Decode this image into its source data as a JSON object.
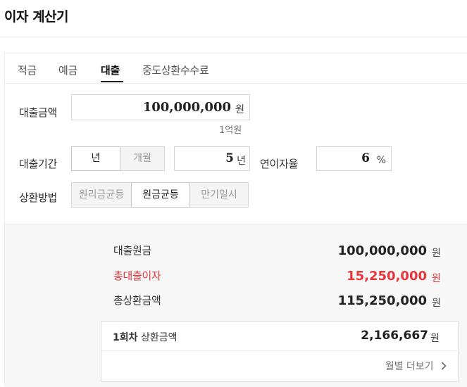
{
  "header": {
    "title": "이자 계산기"
  },
  "tabs": [
    {
      "label": "적금",
      "active": false
    },
    {
      "label": "예금",
      "active": false
    },
    {
      "label": "대출",
      "active": true
    },
    {
      "label": "중도상환수수료",
      "active": false
    }
  ],
  "loan_amount": {
    "label": "대출금액",
    "value": "100,000,000",
    "unit": "원",
    "hint": "1억원"
  },
  "loan_period": {
    "label": "대출기간",
    "options": [
      {
        "label": "년",
        "selected": true
      },
      {
        "label": "개월",
        "selected": false
      }
    ],
    "value": "5",
    "unit": "년"
  },
  "interest_rate": {
    "label": "연이자율",
    "value": "6",
    "unit": "%"
  },
  "repayment_method": {
    "label": "상환방법",
    "options": [
      {
        "label": "원리금균등",
        "selected": false
      },
      {
        "label": "원금균등",
        "selected": true
      },
      {
        "label": "만기일시",
        "selected": false
      }
    ]
  },
  "results": {
    "principal": {
      "label": "대출원금",
      "value": "100,000,000",
      "unit": "원"
    },
    "total_interest": {
      "label": "총대출이자",
      "value": "15,250,000",
      "unit": "원",
      "color": "#e8343b"
    },
    "total_repayment": {
      "label": "총상환금액",
      "value": "115,250,000",
      "unit": "원"
    },
    "first_installment": {
      "label_round": "1회차",
      "label_text": "상환금액",
      "value": "2,166,667",
      "unit": "원",
      "monthly_link": "월별 더보기"
    }
  },
  "icons": {
    "monthly_link_icon": "chevron-right-icon"
  }
}
